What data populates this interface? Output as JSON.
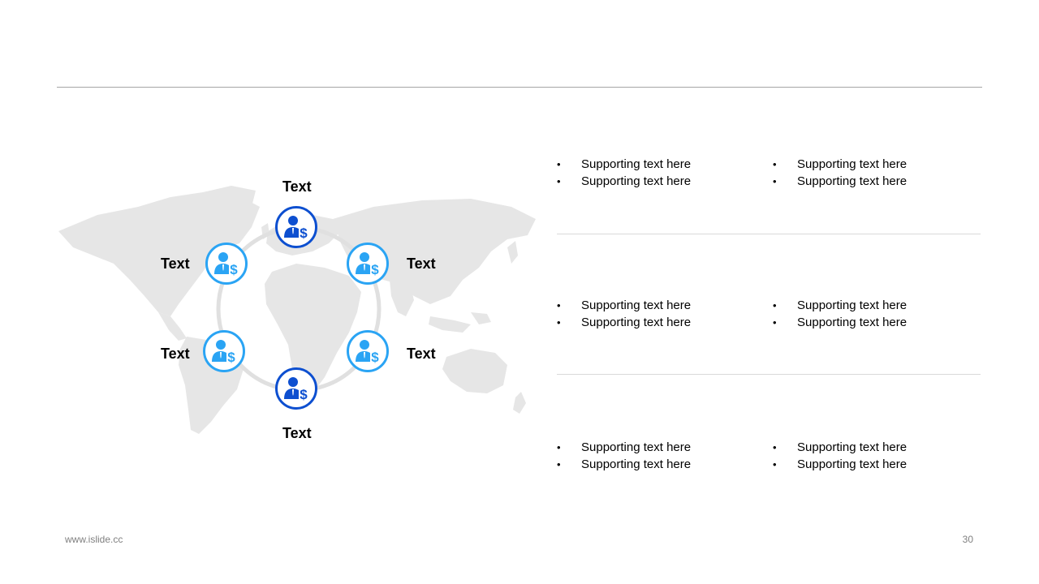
{
  "diagram": {
    "nodes": [
      {
        "label": "Text",
        "icon": "person-dollar-icon",
        "style": "dark"
      },
      {
        "label": "Text",
        "icon": "person-dollar-icon",
        "style": "light"
      },
      {
        "label": "Text",
        "icon": "person-dollar-icon",
        "style": "light"
      },
      {
        "label": "Text",
        "icon": "person-dollar-icon",
        "style": "dark"
      },
      {
        "label": "Text",
        "icon": "person-dollar-icon",
        "style": "light"
      },
      {
        "label": "Text",
        "icon": "person-dollar-icon",
        "style": "light"
      }
    ],
    "background": "world-map"
  },
  "sections": [
    {
      "left": [
        "Supporting text here",
        "Supporting text here"
      ],
      "right": [
        "Supporting text here",
        "Supporting text here"
      ]
    },
    {
      "left": [
        "Supporting text here",
        "Supporting text here"
      ],
      "right": [
        "Supporting text here",
        "Supporting text here"
      ]
    },
    {
      "left": [
        "Supporting text here",
        "Supporting text here"
      ],
      "right": [
        "Supporting text here",
        "Supporting text here"
      ]
    }
  ],
  "footer": {
    "website": "www.islide.cc",
    "page_number": "30"
  },
  "colors": {
    "dark_blue": "#0d4fd0",
    "light_blue": "#2aa4f4",
    "map_gray": "#e6e6e6",
    "ring_gray": "#e0e0e0"
  }
}
